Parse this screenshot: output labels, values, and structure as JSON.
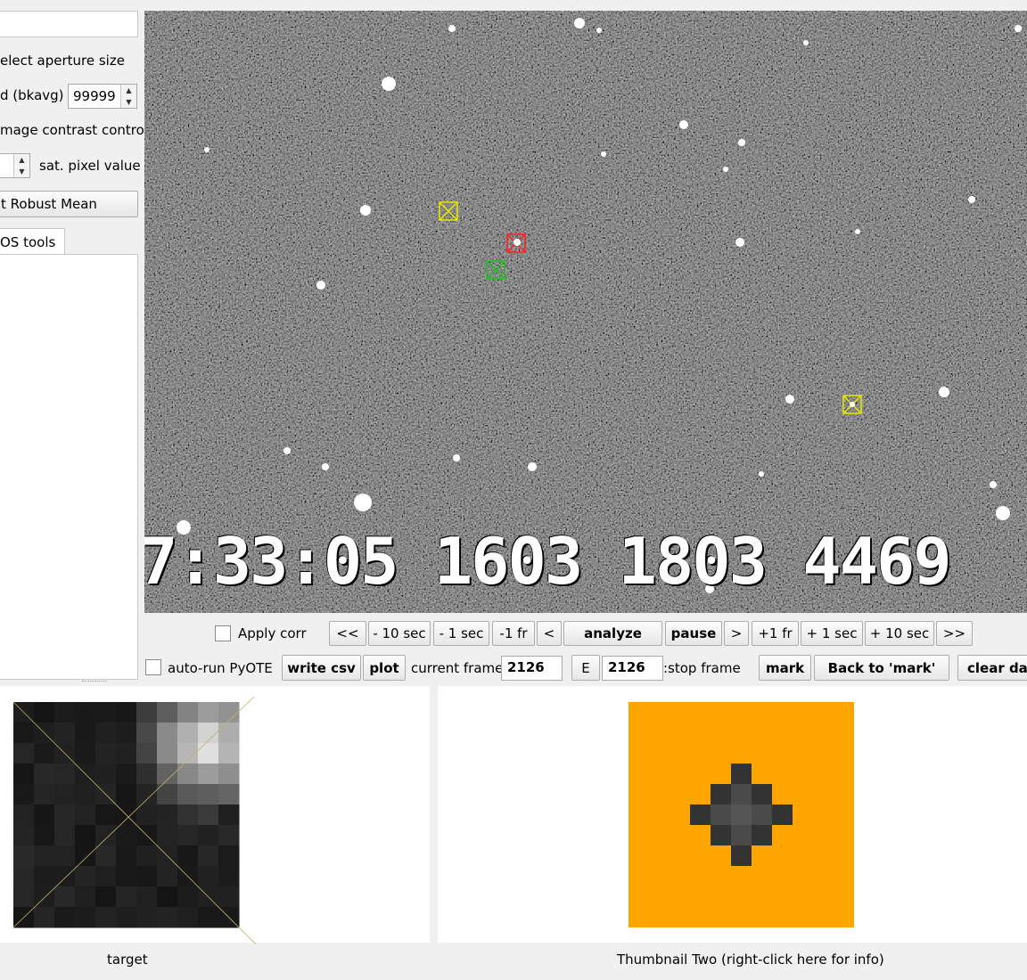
{
  "left_panel": {
    "aperture_label": "elect aperture size",
    "bkavg_label": "d (bkavg)",
    "bkavg_value": "99999",
    "contrast_label": "mage contrast control",
    "sat_label": "sat. pixel value",
    "robust_button": "t Robust Mean",
    "tab_label": "OS tools"
  },
  "video": {
    "timestamp": "7:33:05 1603 1803 4469"
  },
  "controls": {
    "apply_corr": "Apply corr",
    "rewind_start": "<<",
    "minus_10_sec": "- 10 sec",
    "minus_1_sec": "- 1 sec",
    "minus_1_fr": "-1 fr",
    "step_back": "<",
    "analyze": "analyze",
    "pause": "pause",
    "step_fwd": ">",
    "plus_1_fr": "+1 fr",
    "plus_1_sec": "+ 1 sec",
    "plus_10_sec": "+ 10 sec",
    "forward_end": ">>",
    "auto_run": "auto-run PyOTE",
    "write_csv": "write csv",
    "plot": "plot",
    "current_frame_label": "current frame:",
    "current_frame_value": "2126",
    "e_button": "E",
    "stop_frame_value": "2126",
    "stop_frame_label": ":stop frame",
    "mark": "mark",
    "back_to_mark": "Back to 'mark'",
    "clear_data": "clear dat"
  },
  "thumbnails": {
    "target_caption": "target",
    "two_caption": "Thumbnail Two (right-click here for info)"
  },
  "colors": {
    "thumbnail_two_bg": "#ffa500",
    "aperture_yellow": "#e8e800",
    "aperture_red": "#ff2020",
    "aperture_green": "#20c020"
  }
}
